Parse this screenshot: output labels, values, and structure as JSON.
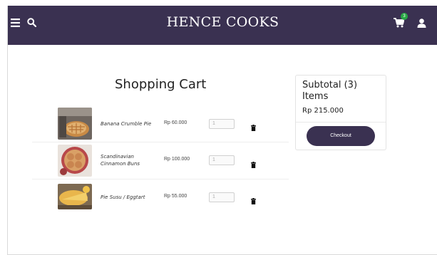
{
  "navbar": {
    "brand": "HENCE COOKS",
    "cart_count": "3",
    "icons": [
      "menu-icon",
      "search-icon",
      "cart-icon",
      "user-icon"
    ],
    "bg_color": "#3a3151"
  },
  "cart": {
    "title": "Shopping Cart",
    "items": [
      {
        "name": "Banana Crumble Pie",
        "price": "Rp 60.000",
        "qty": "1"
      },
      {
        "name_line1": "Scandinavian",
        "name_line2": "Cinnamon Buns",
        "price": "Rp 100.000",
        "qty": "1"
      },
      {
        "name": "Pie Susu / Eggtart",
        "price": "Rp 55.000",
        "qty": "1"
      }
    ]
  },
  "summary": {
    "title": "Subtotal (3) Items",
    "total": "Rp 215.000",
    "checkout_label": "Checkout"
  }
}
